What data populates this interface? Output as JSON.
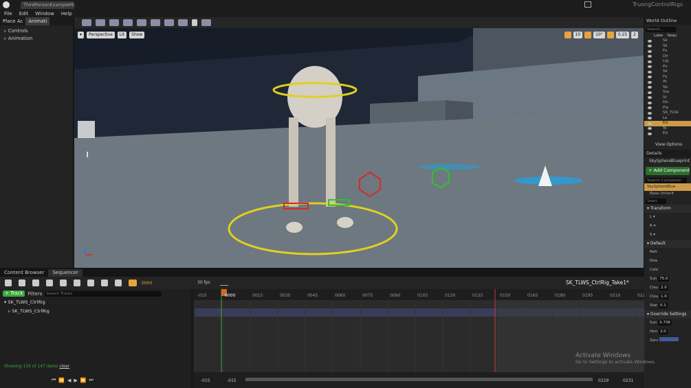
{
  "window": {
    "doc_tab": "ThirdPersonExampleMap*",
    "project_name": "TruongControlRigs"
  },
  "menu": [
    "File",
    "Edit",
    "Window",
    "Help"
  ],
  "left_panel": {
    "tabs": [
      "Place Ac",
      "Animati"
    ],
    "sections": [
      "Controls",
      "Animation"
    ]
  },
  "viewport": {
    "view_mode": "Perspective",
    "lit": "Lit",
    "show": "Show",
    "snap": {
      "grid": "10",
      "angle": "10°",
      "scale": "0.25",
      "camera_speed": "2"
    }
  },
  "world_outliner": {
    "title": "World Outline",
    "search_placeholder": "Search...",
    "columns": [
      "Labe",
      "Sequ"
    ],
    "rows": [
      "Sk",
      "Sk",
      "Fo",
      "Dir",
      "Lig",
      "Po",
      "Sk",
      "Fo",
      "At",
      "Sp",
      "Sta",
      "St",
      "Do",
      "Pla",
      "SK_TLSk",
      "Le",
      "Ed",
      "Te",
      "Ed"
    ],
    "view_options": "View Options"
  },
  "details": {
    "title": "Details",
    "actor_name": "SkySphereBlueprint",
    "add_component": "+ Add Component",
    "search_components": "Search Componen",
    "component_selected": "SkySphereBlue",
    "inherited": "Base (Inherit",
    "search": "Searc",
    "transform": {
      "label": "Transform",
      "rows": [
        "L",
        "R",
        "S"
      ]
    },
    "default": {
      "label": "Default",
      "rows": [
        "Refr",
        "Dire",
        "Colo",
        "Sun",
        "Clou",
        "Clou",
        "Star"
      ],
      "values": [
        "75.0",
        "2.0",
        "1.0",
        "0.1"
      ]
    },
    "override": {
      "label": "Override Settings",
      "rows": [
        "Sun",
        "Hori",
        "Zeni"
      ],
      "values": [
        "0.736",
        "3.0"
      ]
    }
  },
  "bottom_tabs": [
    "Content Browser",
    "Sequencer"
  ],
  "sequencer": {
    "track_button": "+ Track",
    "filters": "Filters",
    "search_placeholder": "Search Tracks",
    "current_frame": "0000",
    "fps": "30 fps",
    "sequence_name": "SK_TLWS_CtrlRig_Take1*",
    "tracks": [
      "SK_TLWS_CtrlRig",
      "SK_TLWS_CtrlRig"
    ],
    "ruler": [
      "-015",
      "0000",
      "0015",
      "0030",
      "0045",
      "0060",
      "0075",
      "0090",
      "0105",
      "0120",
      "0135",
      "0150",
      "0165",
      "0180",
      "0195",
      "0210",
      "022"
    ],
    "range_start": "-015",
    "range_start2": "-015",
    "range_end": "0229",
    "range_end2": "0231",
    "status": "Showing 133 of 147 items",
    "clear": "clear"
  },
  "watermark": {
    "line1": "Activate Windows",
    "line2": "Go to Settings to activate Windows."
  },
  "colors": {
    "accent_orange": "#e8a33a",
    "selection_yellow": "#e0d020",
    "control_red": "#d42a2a",
    "control_green": "#2ec22e",
    "track_green": "#3ca93c"
  }
}
